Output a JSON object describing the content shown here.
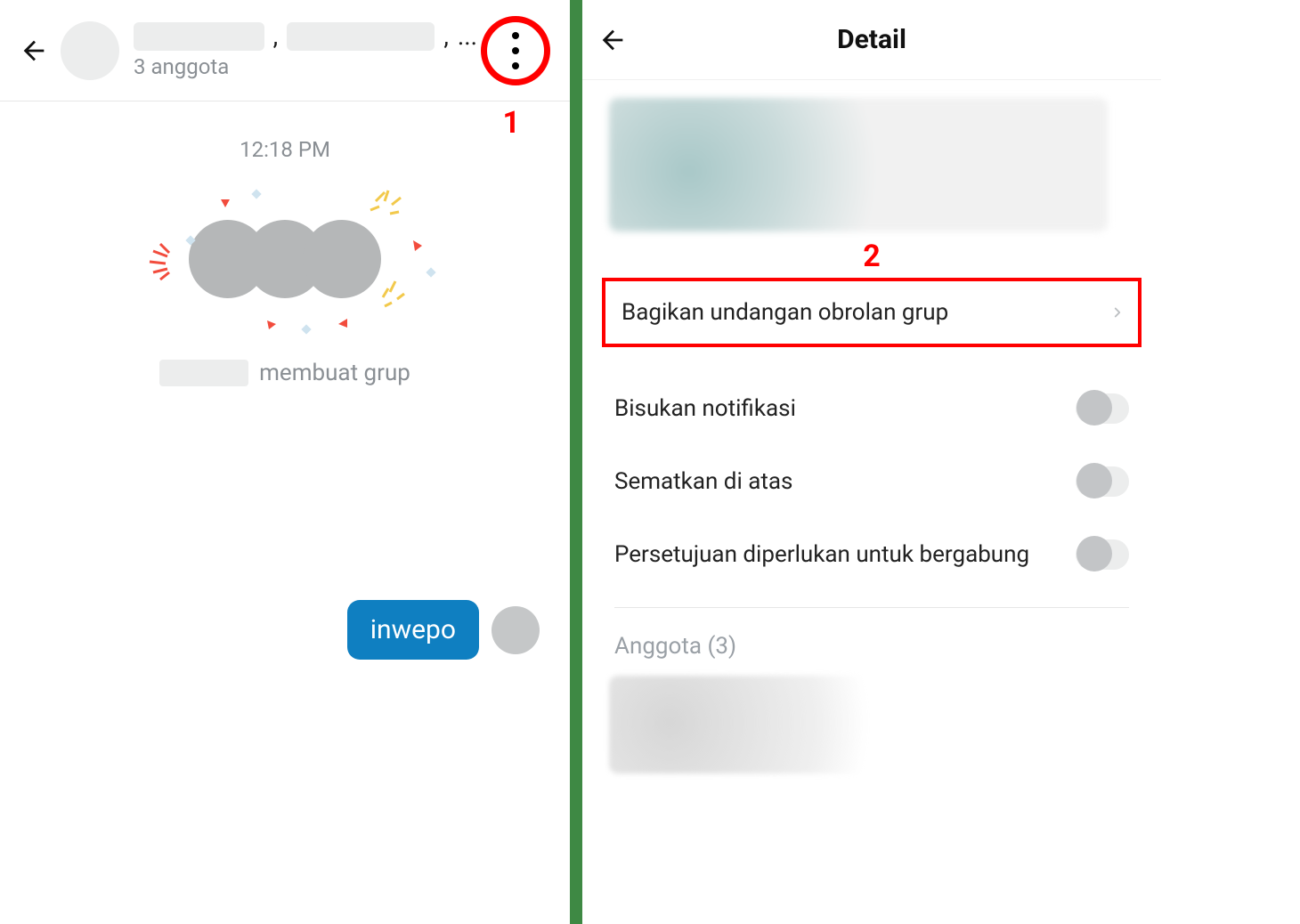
{
  "left": {
    "subtitle": "3 anggota",
    "comma": ",",
    "ellipsis": "...",
    "timestamp": "12:18 PM",
    "created_suffix": "membuat grup",
    "message_text": "inwepo"
  },
  "right": {
    "title": "Detail",
    "share_invite_label": "Bagikan undangan obrolan grup",
    "settings": [
      {
        "label": "Bisukan notifikasi",
        "on": false
      },
      {
        "label": "Sematkan di atas",
        "on": false
      },
      {
        "label": "Persetujuan diperlukan untuk bergabung",
        "on": false
      }
    ],
    "members_label": "Anggota (3)"
  },
  "callouts": {
    "one": "1",
    "two": "2"
  }
}
